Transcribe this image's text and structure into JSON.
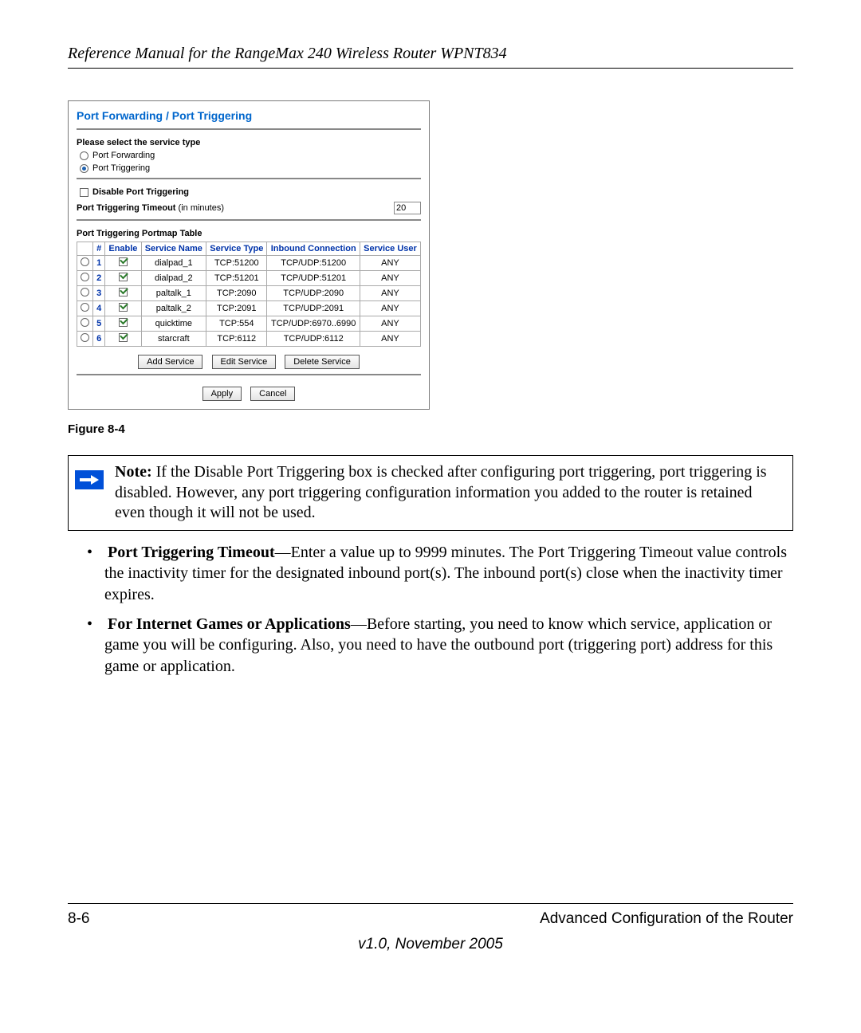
{
  "header": {
    "title": "Reference Manual for the RangeMax 240 Wireless Router WPNT834"
  },
  "screenshot": {
    "title": "Port Forwarding / Port Triggering",
    "service_type_label": "Please select the service type",
    "radio_forwarding": "Port Forwarding",
    "radio_triggering": "Port Triggering",
    "disable_label": "Disable Port Triggering",
    "timeout_label_bold": "Port Triggering Timeout",
    "timeout_label_plain": " (in minutes)",
    "timeout_value": "20",
    "portmap_title": "Port Triggering Portmap Table",
    "headers": {
      "radio": "",
      "num": "#",
      "enable": "Enable",
      "service_name": "Service Name",
      "service_type": "Service Type",
      "inbound": "Inbound Connection",
      "user": "Service User"
    },
    "rows": [
      {
        "num": "1",
        "name": "dialpad_1",
        "type": "TCP:51200",
        "inbound": "TCP/UDP:51200",
        "user": "ANY"
      },
      {
        "num": "2",
        "name": "dialpad_2",
        "type": "TCP:51201",
        "inbound": "TCP/UDP:51201",
        "user": "ANY"
      },
      {
        "num": "3",
        "name": "paltalk_1",
        "type": "TCP:2090",
        "inbound": "TCP/UDP:2090",
        "user": "ANY"
      },
      {
        "num": "4",
        "name": "paltalk_2",
        "type": "TCP:2091",
        "inbound": "TCP/UDP:2091",
        "user": "ANY"
      },
      {
        "num": "5",
        "name": "quicktime",
        "type": "TCP:554",
        "inbound": "TCP/UDP:6970..6990",
        "user": "ANY"
      },
      {
        "num": "6",
        "name": "starcraft",
        "type": "TCP:6112",
        "inbound": "TCP/UDP:6112",
        "user": "ANY"
      }
    ],
    "buttons": {
      "add": "Add Service",
      "edit": "Edit Service",
      "delete": "Delete Service",
      "apply": "Apply",
      "cancel": "Cancel"
    }
  },
  "figure_caption": "Figure 8-4",
  "note": {
    "label": "Note:",
    "text": " If the Disable Port Triggering box is checked after configuring port triggering, port triggering is disabled. However, any port triggering configuration information you added to the router is retained even though it will not be used."
  },
  "bullets": {
    "b1_bold": "Port Triggering Timeout",
    "b1_text": "—Enter a value up to 9999 minutes. The Port Triggering Timeout value controls the inactivity timer for the designated inbound port(s). The inbound port(s) close when the inactivity timer expires.",
    "b2_bold": "For Internet Games or Applications",
    "b2_text": "—Before starting, you need to know which service, application or game you will be configuring. Also, you need to have the outbound port (triggering port) address for this game or application."
  },
  "footer": {
    "page": "8-6",
    "section": "Advanced Configuration of the Router",
    "version": "v1.0, November 2005"
  }
}
